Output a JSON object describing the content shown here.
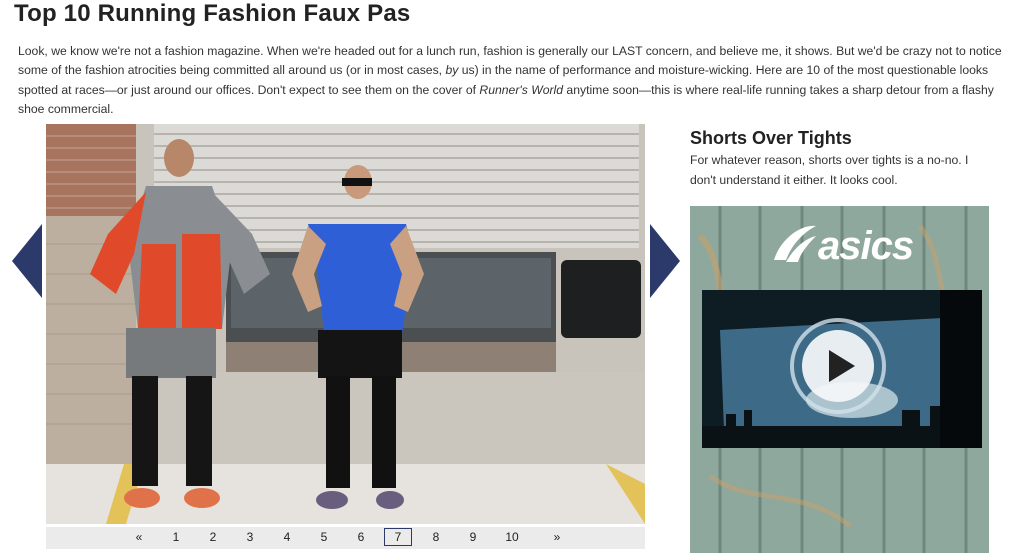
{
  "article": {
    "title": "Top 10 Running Fashion Faux Pas",
    "intro_1": "Look, we know we're not a fashion magazine. When we're headed out for a lunch run, fashion is generally our LAST concern, and believe me, it shows. But we'd be crazy not to notice some of the fashion atrocities being committed all around us (or in most cases, ",
    "intro_em1": "by",
    "intro_2": " us) in the name of performance and moisture-wicking. Here are 10 of the most questionable looks spotted at races—or just around our offices. Don't expect to see them on the cover of ",
    "intro_em2": "Runner's World",
    "intro_3": " anytime soon—this is where real-life running takes a sharp detour from a flashy shoe commercial."
  },
  "gallery": {
    "pager": {
      "prev": "«",
      "pages": [
        "1",
        "2",
        "3",
        "4",
        "5",
        "6",
        "7",
        "8",
        "9",
        "10"
      ],
      "current": "7",
      "next": "»"
    }
  },
  "slide": {
    "title": "Shorts Over Tights",
    "description": "For whatever reason, shorts over tights is a no-no. I don't understand it either. It looks cool."
  },
  "ad": {
    "brand": "asics"
  },
  "colors": {
    "accent": "#2b3a6b"
  }
}
